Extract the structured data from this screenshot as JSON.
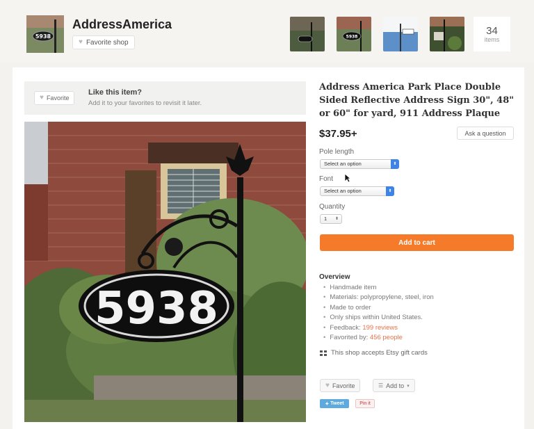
{
  "shop": {
    "name": "AddressAmerica",
    "favorite_shop_label": "Favorite shop",
    "items_count": "34",
    "items_label": "items"
  },
  "like_bar": {
    "favorite_label": "Favorite",
    "title": "Like this item?",
    "subtitle": "Add it to your favorites to revisit it later."
  },
  "product": {
    "title": "Address America Park Place Double Sided Reflective Address Sign 30\", 48\" or 60\" for yard, 911 Address Plaque",
    "price": "$37.95+",
    "ask_question_label": "Ask a question",
    "sign_number": "5938",
    "pole_length": {
      "label": "Pole length",
      "value": "Select an option"
    },
    "font": {
      "label": "Font",
      "value": "Select an option"
    },
    "quantity": {
      "label": "Quantity",
      "value": "1"
    },
    "add_to_cart_label": "Add to cart"
  },
  "overview": {
    "title": "Overview",
    "items": [
      "Handmade item",
      "Materials: polypropylene, steel, iron",
      "Made to order",
      "Only ships within United States."
    ],
    "feedback_prefix": "Feedback: ",
    "feedback_link": "199 reviews",
    "favorited_prefix": "Favorited by: ",
    "favorited_link": "456 people",
    "gift_cards_text": "This shop accepts Etsy gift cards"
  },
  "actions": {
    "favorite_label": "Favorite",
    "add_to_label": "Add to",
    "tweet_label": "Tweet",
    "pin_label": "Pin it"
  },
  "icons": [
    "heart-icon",
    "chevron-down-icon",
    "gift-card-icon",
    "cursor-icon"
  ],
  "colors": {
    "cart": "#f57b2a",
    "link": "#e8744a",
    "select_arrow": "#3d84e6",
    "tweet": "#5ea9dd"
  }
}
